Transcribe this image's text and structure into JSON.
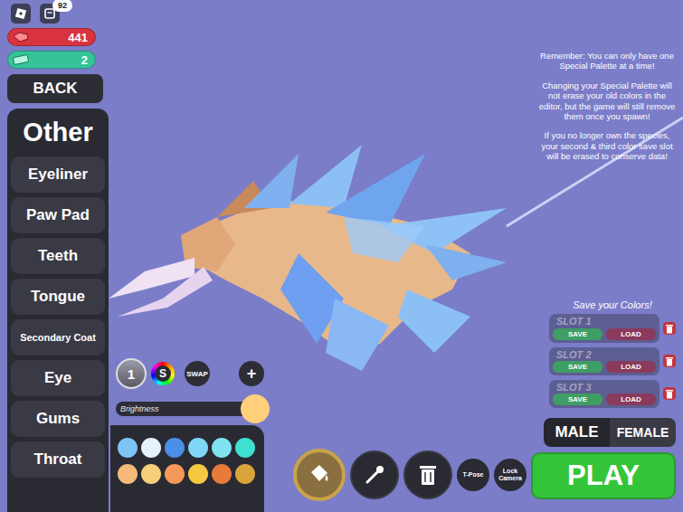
{
  "topbar": {
    "badge": "92"
  },
  "currency": [
    {
      "value": "441",
      "color": "#d8333f"
    },
    {
      "value": "2",
      "color": "#35c49a"
    }
  ],
  "back_button": "BACK",
  "sidebar": {
    "title": "Other",
    "items": [
      {
        "label": "Eyeliner"
      },
      {
        "label": "Paw Pad"
      },
      {
        "label": "Teeth"
      },
      {
        "label": "Tongue"
      },
      {
        "label": "Secondary Coat"
      },
      {
        "label": "Eye"
      },
      {
        "label": "Gums"
      },
      {
        "label": "Throat"
      }
    ]
  },
  "editor": {
    "slot": "1",
    "special": "S",
    "swap": "SWAP",
    "add": "+",
    "brightness": {
      "label": "Brightness",
      "level": 1,
      "color": "#ffcf7a"
    },
    "swatches": [
      "#7fc4f5",
      "#e6f2fa",
      "#4a8fe8",
      "#7fd6f5",
      "#7fe3f0",
      "#3fe0d0",
      "#f5b97a",
      "#f7cf7a",
      "#f5995a",
      "#f5c842",
      "#e87a3a",
      "#d9a53a"
    ]
  },
  "tools": [
    {
      "kind": "bucket",
      "label": "",
      "selected": true
    },
    {
      "kind": "dropper",
      "label": "",
      "selected": false
    },
    {
      "kind": "trash",
      "label": "",
      "selected": false
    },
    {
      "kind": "text",
      "label": "T-Pose",
      "selected": false
    },
    {
      "kind": "text",
      "label": "Lock Camera",
      "selected": false
    }
  ],
  "notice": [
    "Remember: You can only have one Special Palette at a time!",
    "Changing your Special Palette will not erase your old colors in the editor, but the game will still remove them once you spawn!",
    "If you no longer own the species, your second & third color save slot will be erased to conserve data!"
  ],
  "save": {
    "title": "Save your Colors!",
    "slots": [
      {
        "label": "SLOT 1",
        "save": "SAVE",
        "load": "LOAD"
      },
      {
        "label": "SLOT 2",
        "save": "SAVE",
        "load": "LOAD"
      },
      {
        "label": "SLOT 3",
        "save": "SAVE",
        "load": "LOAD"
      }
    ]
  },
  "gender": [
    {
      "label": "MALE",
      "selected": true
    },
    {
      "label": "FEMALE",
      "selected": false
    }
  ],
  "play": "PLAY"
}
